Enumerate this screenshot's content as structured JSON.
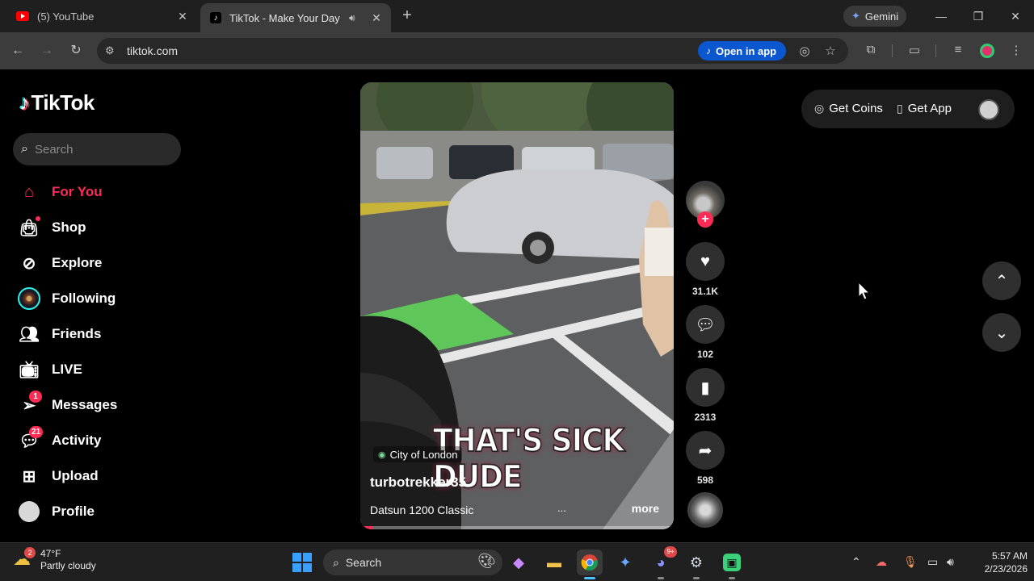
{
  "browser": {
    "tabs": [
      {
        "title": "(5) YouTube",
        "icon": "youtube-icon",
        "active": false
      },
      {
        "title": "TikTok - Make Your Day",
        "icon": "tiktok-icon",
        "active": true
      }
    ],
    "gemini_label": "Gemini",
    "url": "tiktok.com",
    "open_in_app_label": "Open in app"
  },
  "sidebar": {
    "logo_text": "TikTok",
    "search_placeholder": "Search",
    "items": [
      {
        "label": "For You",
        "icon": "home-icon",
        "active": true
      },
      {
        "label": "Shop",
        "icon": "shop-bag-icon"
      },
      {
        "label": "Explore",
        "icon": "compass-icon"
      },
      {
        "label": "Following",
        "icon": "following-avatar"
      },
      {
        "label": "Friends",
        "icon": "friends-icon"
      },
      {
        "label": "LIVE",
        "icon": "live-tv-icon"
      },
      {
        "label": "Messages",
        "icon": "send-icon",
        "badge": "1"
      },
      {
        "label": "Activity",
        "icon": "activity-icon",
        "badge": "21"
      },
      {
        "label": "Upload",
        "icon": "upload-plus-icon"
      },
      {
        "label": "Profile",
        "icon": "profile-avatar"
      }
    ]
  },
  "video": {
    "caption": "THAT'S SICK DUDE",
    "location": "City of London",
    "author": "turbotrekker35",
    "description": "Datsun 1200 Classic",
    "ellipsis": "...",
    "more_label": "more",
    "progress_fraction": 0.04
  },
  "actions": {
    "likes": "31.1K",
    "comments": "102",
    "saves": "2313",
    "shares": "598"
  },
  "top_right": {
    "coins_label": "Get Coins",
    "app_label": "Get App"
  },
  "taskbar": {
    "weather_temp": "47°F",
    "weather_desc": "Partly cloudy",
    "weather_badge": "2",
    "search_label": "Search",
    "discord_badge": "9+",
    "time": "5:57 AM",
    "date": "2/23/2026"
  },
  "colors": {
    "accent": "#fe2c55",
    "chrome_bg": "#3c3c3c",
    "open_app_blue": "#0b57d0"
  }
}
